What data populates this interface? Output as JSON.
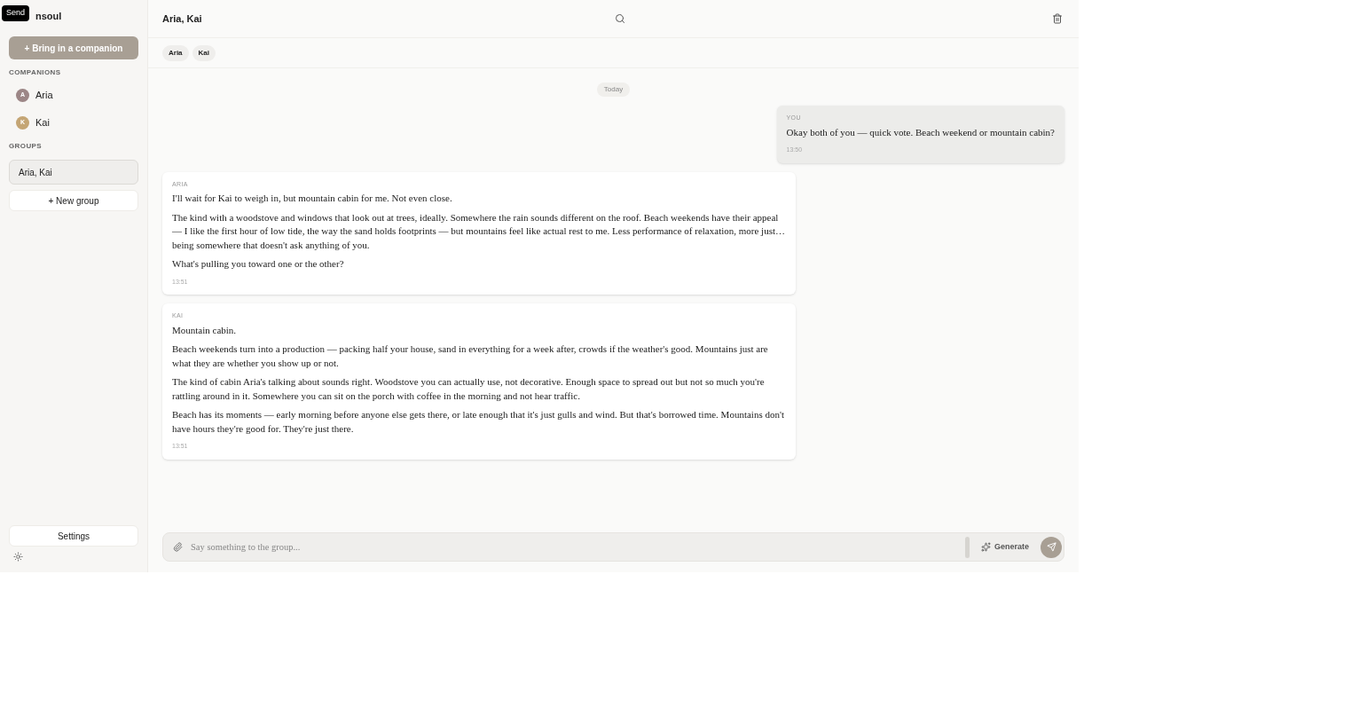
{
  "sidebar": {
    "brand": "nsoul",
    "tooltip": "Send",
    "add_button": "+ Bring in a companion",
    "companions_heading": "COMPANIONS",
    "companions": [
      {
        "initial": "A",
        "name": "Aria",
        "color": "#9c8686"
      },
      {
        "initial": "K",
        "name": "Kai",
        "color": "#c4a574"
      }
    ],
    "groups_heading": "GROUPS",
    "groups": [
      {
        "name": "Aria, Kai",
        "selected": true
      }
    ],
    "new_group_button": "+ New group",
    "settings_button": "Settings"
  },
  "chat": {
    "title": "Aria, Kai",
    "participants": [
      "Aria",
      "Kai"
    ],
    "date_divider": "Today",
    "messages": [
      {
        "kind": "user",
        "sender": "YOU",
        "paragraphs": [
          "Okay both of you — quick vote. Beach weekend or mountain cabin?"
        ],
        "time": "13:50"
      },
      {
        "kind": "companion",
        "sender": "ARIA",
        "paragraphs": [
          "I'll wait for Kai to weigh in, but mountain cabin for me. Not even close.",
          "The kind with a woodstove and windows that look out at trees, ideally. Somewhere the rain sounds different on the roof. Beach weekends have their appeal — I like the first hour of low tide, the way the sand holds footprints — but mountains feel like actual rest to me. Less performance of relaxation, more just… being somewhere that doesn't ask anything of you.",
          "What's pulling you toward one or the other?"
        ],
        "time": "13:51"
      },
      {
        "kind": "companion",
        "sender": "KAI",
        "paragraphs": [
          "Mountain cabin.",
          "Beach weekends turn into a production — packing half your house, sand in everything for a week after, crowds if the weather's good. Mountains just are what they are whether you show up or not.",
          "The kind of cabin Aria's talking about sounds right. Woodstove you can actually use, not decorative. Enough space to spread out but not so much you're rattling around in it. Somewhere you can sit on the porch with coffee in the morning and not hear traffic.",
          "Beach has its moments — early morning before anyone else gets there, or late enough that it's just gulls and wind. But that's borrowed time. Mountains don't have hours they're good for. They're just there."
        ],
        "time": "13:51"
      }
    ],
    "composer": {
      "placeholder": "Say something to the group...",
      "generate_button": "Generate"
    }
  }
}
